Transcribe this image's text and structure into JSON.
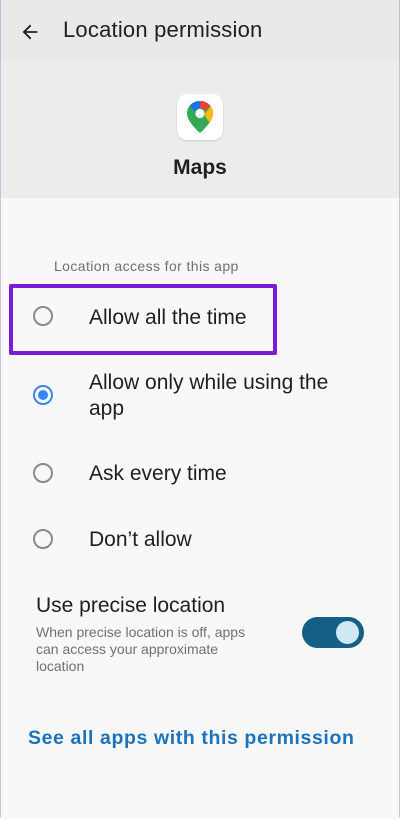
{
  "topbar": {
    "title": "Location permission",
    "back_icon": "arrow-left-icon"
  },
  "app": {
    "name": "Maps",
    "icon": "google-maps-pin-icon"
  },
  "section": {
    "label": "Location access for this app"
  },
  "options": [
    {
      "label": "Allow all the time",
      "selected": false,
      "highlighted": true
    },
    {
      "label": "Allow only while using the app",
      "selected": true,
      "highlighted": false
    },
    {
      "label": "Ask every time",
      "selected": false,
      "highlighted": false
    },
    {
      "label": "Don’t allow",
      "selected": false,
      "highlighted": false
    }
  ],
  "precise": {
    "title": "Use precise location",
    "description": "When precise location is off, apps can access your approximate location",
    "enabled": true
  },
  "link": {
    "label": "See all apps with this permission"
  },
  "colors": {
    "accent": "#3a86f0",
    "highlight_box": "#7a1bd6",
    "toggle_track": "#155f86",
    "link": "#1a73bb"
  }
}
